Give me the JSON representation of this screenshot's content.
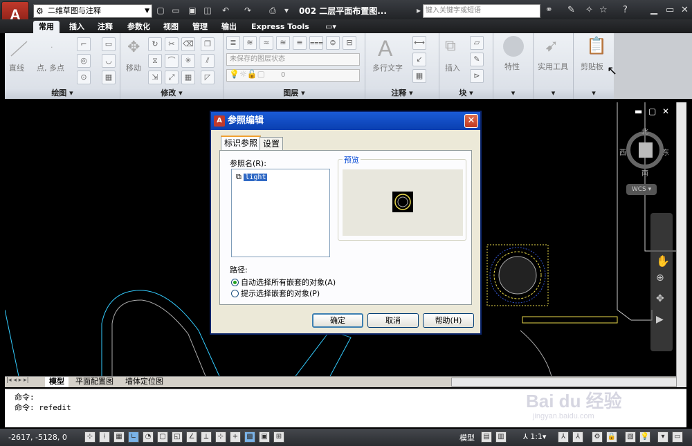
{
  "app": {
    "logo_letter": "A",
    "workspace": "二维草图与注释",
    "doc_title": "002 二层平面布置图...",
    "search_placeholder": "键入关键字或短语"
  },
  "ribbon_tabs": [
    "常用",
    "插入",
    "注释",
    "参数化",
    "视图",
    "管理",
    "输出",
    "Express Tools"
  ],
  "ribbon": {
    "draw": {
      "label": "绘图 ▾",
      "line": "直线",
      "point": "点, 多点"
    },
    "modify": {
      "label": "修改 ▾",
      "move": "移动"
    },
    "layers": {
      "label": "图层 ▾",
      "layer_state": "未保存的图层状态",
      "layer_current": "0"
    },
    "annotation": {
      "label": "注释 ▾",
      "mtext": "多行文字"
    },
    "block": {
      "label": "块 ▾",
      "insert": "插入"
    },
    "properties": {
      "label": "特性"
    },
    "utilities": {
      "label": "实用工具"
    },
    "clipboard": {
      "label": "剪贴板"
    }
  },
  "viewcube": {
    "north": "北",
    "south": "南",
    "east": "东",
    "west": "西",
    "wcs": "WCS"
  },
  "layout_tabs": [
    "模型",
    "平面配置图",
    "墙体定位图"
  ],
  "command": {
    "line1": "命令:",
    "line2": "命令: refedit"
  },
  "status": {
    "coords": "-2617, -5128, 0",
    "model": "模型",
    "scale": "1:1"
  },
  "dialog": {
    "title": "参照编辑",
    "tabs": [
      "标识参照",
      "设置"
    ],
    "ref_name_label": "参照名(R):",
    "ref_item": "light",
    "preview_label": "预览",
    "path_label": "路径:",
    "option_auto": "自动选择所有嵌套的对象(A)",
    "option_prompt": "提示选择嵌套的对象(P)",
    "ok": "确定",
    "cancel": "取消",
    "help": "帮助(H)"
  },
  "watermark": {
    "brand": "Bai du 经验",
    "url": "jingyan.baidu.com"
  },
  "colors": {
    "accent": "#0a3fb0",
    "canvas_bg": "#000000",
    "cyan_line": "#33ccff",
    "yellow_line": "#e8d84a"
  }
}
